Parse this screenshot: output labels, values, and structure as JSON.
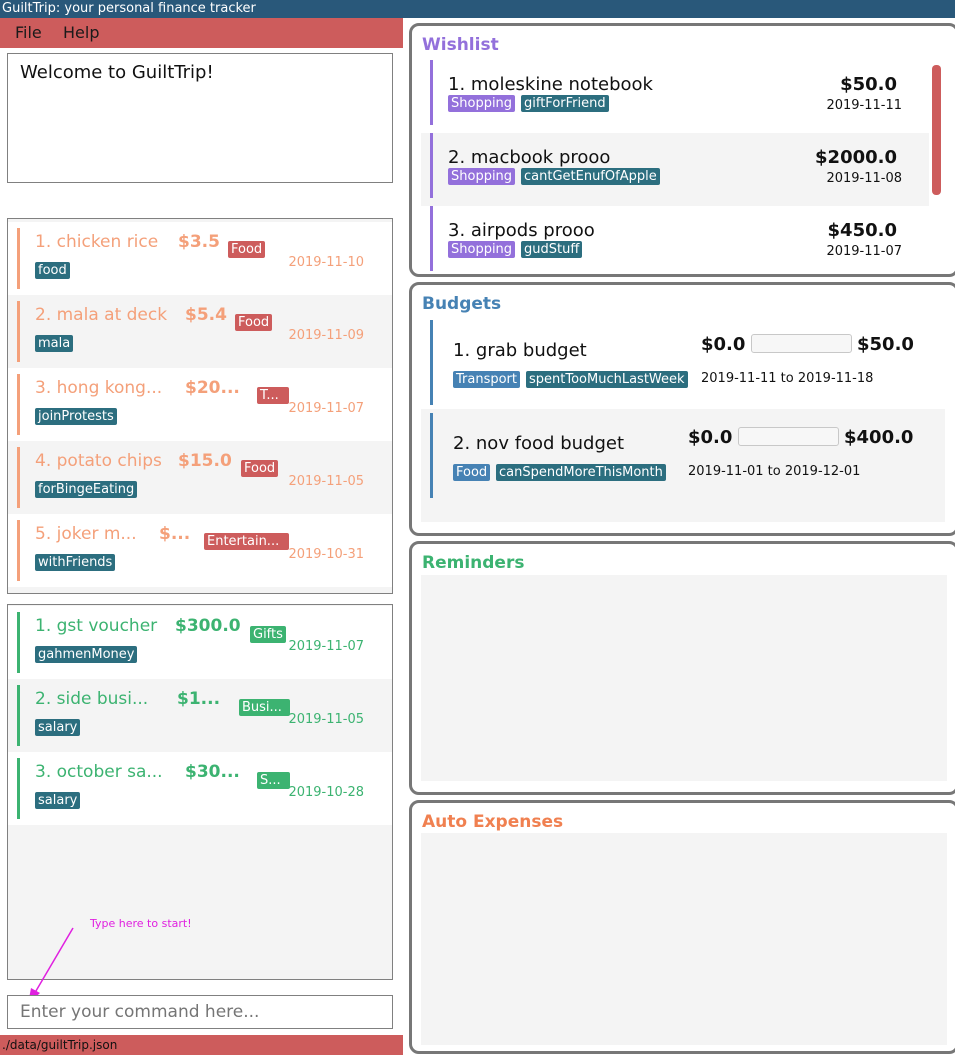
{
  "window": {
    "title": "GuiltTrip: your personal finance tracker"
  },
  "menu": {
    "file": "File",
    "help": "Help"
  },
  "result": {
    "text": "Welcome to GuiltTrip!"
  },
  "expenses": [
    {
      "title": "1.  chicken rice",
      "amount": "$3.5",
      "category": "Food",
      "tag": "food",
      "date": "2019-11-10"
    },
    {
      "title": "2.  mala at deck",
      "amount": "$5.4",
      "category": "Food",
      "tag": "mala",
      "date": "2019-11-09"
    },
    {
      "title": "3.  hong kong...",
      "amount": "$20...",
      "category": "T...",
      "tag": "joinProtests",
      "date": "2019-11-07"
    },
    {
      "title": "4.  potato chips",
      "amount": "$15.0",
      "category": "Food",
      "tag": "forBingeEating",
      "date": "2019-11-05"
    },
    {
      "title": "5.  joker m...",
      "amount": "$...",
      "category": "Entertain...",
      "tag": "withFriends",
      "date": "2019-10-31"
    }
  ],
  "incomes": [
    {
      "title": "1.  gst voucher",
      "amount": "$300.0",
      "category": "Gifts",
      "tag": "gahmenMoney",
      "date": "2019-11-07"
    },
    {
      "title": "2.  side busi...",
      "amount": "$1...",
      "category": "Busi...",
      "tag": "salary",
      "date": "2019-11-05"
    },
    {
      "title": "3.  october sa...",
      "amount": "$30...",
      "category": "S...",
      "tag": "salary",
      "date": "2019-10-28"
    }
  ],
  "hint": "Type here to start!",
  "command": {
    "placeholder": "Enter your command here..."
  },
  "status": {
    "path": "./data/guiltTrip.json"
  },
  "wishlist": {
    "heading": "Wishlist",
    "items": [
      {
        "title": "1.  moleskine notebook",
        "amount": "$50.0",
        "category": "Shopping",
        "tag": "giftForFriend",
        "date": "2019-11-11"
      },
      {
        "title": "2.  macbook prooo",
        "amount": "$2000.0",
        "category": "Shopping",
        "tag": "cantGetEnufOfApple",
        "date": "2019-11-08"
      },
      {
        "title": "3.  airpods prooo",
        "amount": "$450.0",
        "category": "Shopping",
        "tag": "gudStuff",
        "date": "2019-11-07"
      }
    ]
  },
  "budgets": {
    "heading": "Budgets",
    "items": [
      {
        "title": "1.  grab budget",
        "spent": "$0.0",
        "limit": "$50.0",
        "progress": 0,
        "category": "Transport",
        "tag": "spentTooMuchLastWeek",
        "period": "2019-11-11 to 2019-11-18"
      },
      {
        "title": "2.  nov food budget",
        "spent": "$0.0",
        "limit": "$400.0",
        "progress": 0,
        "category": "Food",
        "tag": "canSpendMoreThisMonth",
        "period": "2019-11-01 to 2019-12-01"
      }
    ]
  },
  "reminders": {
    "heading": "Reminders"
  },
  "autoexpenses": {
    "heading": "Auto Expenses"
  },
  "colors": {
    "titlebar": "#29587a",
    "menubar": "#cd5c5c",
    "expense": "#f4a07a",
    "income": "#3cb371",
    "wishlist": "#9370db",
    "budget": "#4682b4",
    "autoexpense": "#f08050",
    "tag": "#2c6e7f"
  },
  "icons": {
    "hint_arrow": "arrow-pointer-icon"
  }
}
